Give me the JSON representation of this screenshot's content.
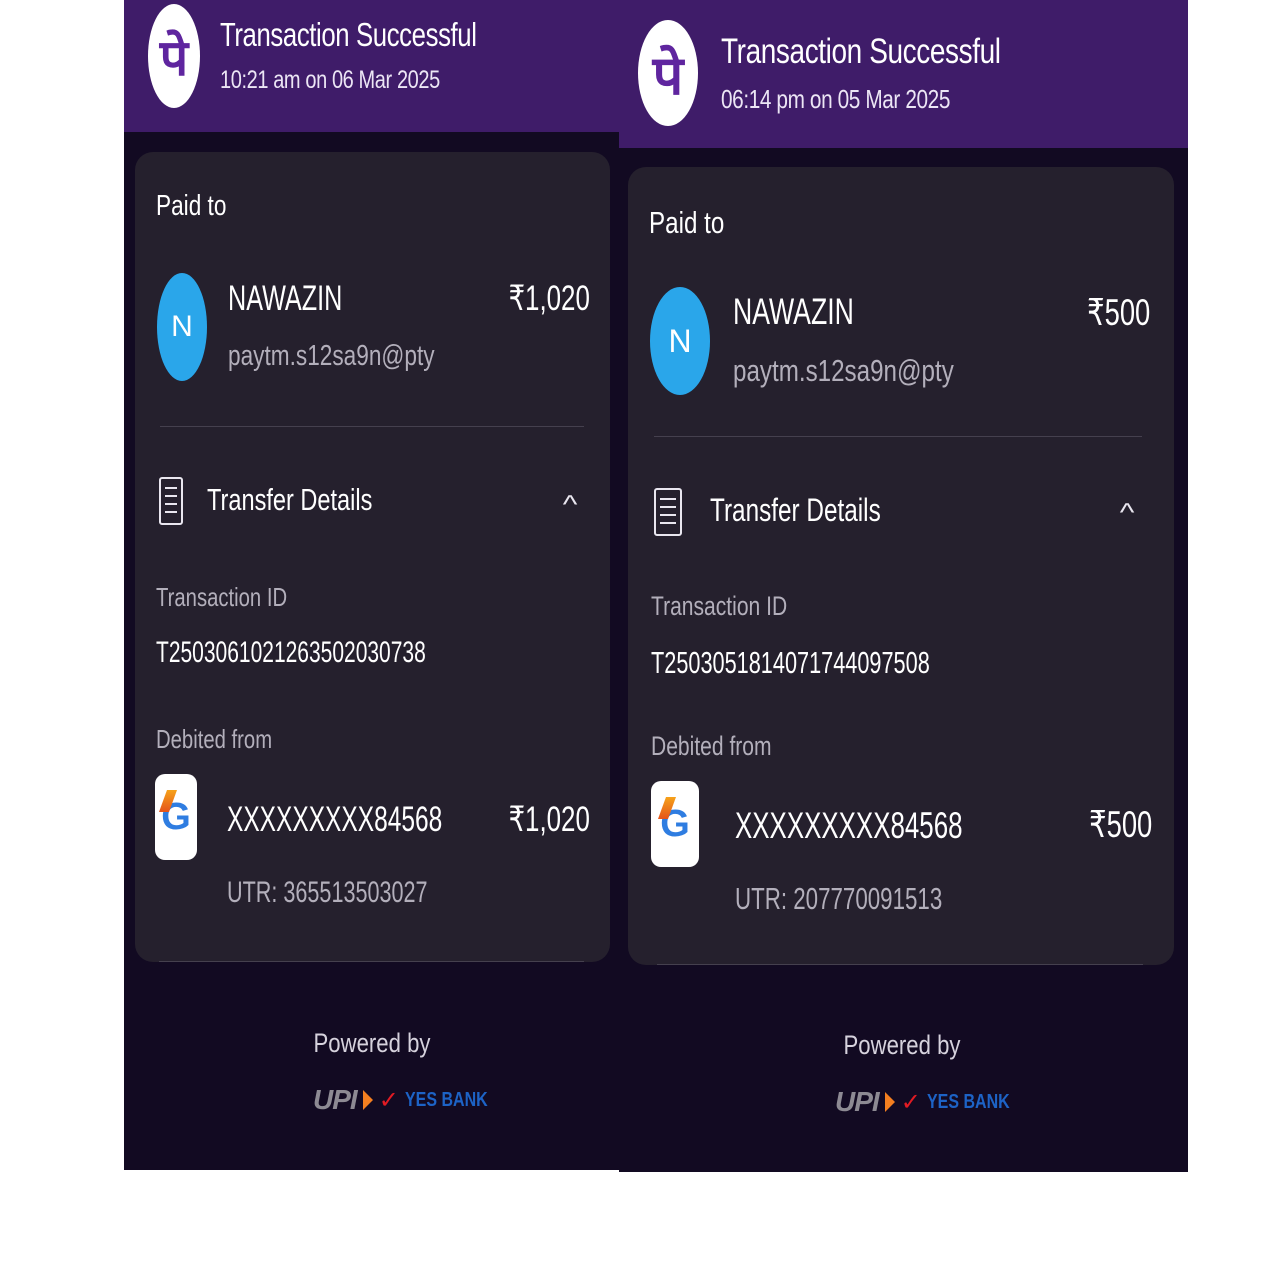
{
  "receipts": [
    {
      "header": {
        "app_logo_glyph": "पे",
        "title": "Transaction Successful",
        "timestamp": "10:21 am on 06 Mar 2025"
      },
      "paid_to_label": "Paid to",
      "payee": {
        "avatar_letter": "N",
        "name": "NAWAZIN",
        "upi_id": "paytm.s12sa9n@pty",
        "amount": "₹1,020"
      },
      "transfer_details_label": "Transfer Details",
      "transaction_id_label": "Transaction ID",
      "transaction_id": "T2503061021263502030738",
      "debited_from_label": "Debited from",
      "account": {
        "number": "XXXXXXXXX84568",
        "amount": "₹1,020",
        "utr": "UTR: 365513503027"
      },
      "powered_by": "Powered by"
    },
    {
      "header": {
        "app_logo_glyph": "पे",
        "title": "Transaction Successful",
        "timestamp": "06:14 pm on 05 Mar 2025"
      },
      "paid_to_label": "Paid to",
      "payee": {
        "avatar_letter": "N",
        "name": "NAWAZIN",
        "upi_id": "paytm.s12sa9n@pty",
        "amount": "₹500"
      },
      "transfer_details_label": "Transfer Details",
      "transaction_id_label": "Transaction ID",
      "transaction_id": "T2503051814071744097508",
      "debited_from_label": "Debited from",
      "account": {
        "number": "XXXXXXXXX84568",
        "amount": "₹500",
        "utr": "UTR: 207770091513"
      },
      "powered_by": "Powered by"
    }
  ],
  "partner_logos": {
    "upi": "UPI",
    "bank": "YES BANK"
  },
  "colors": {
    "header_bg": "#3f1c69",
    "screen_bg": "#120a22",
    "card_bg": "#25202d",
    "avatar_bg": "#2aa6ea"
  }
}
